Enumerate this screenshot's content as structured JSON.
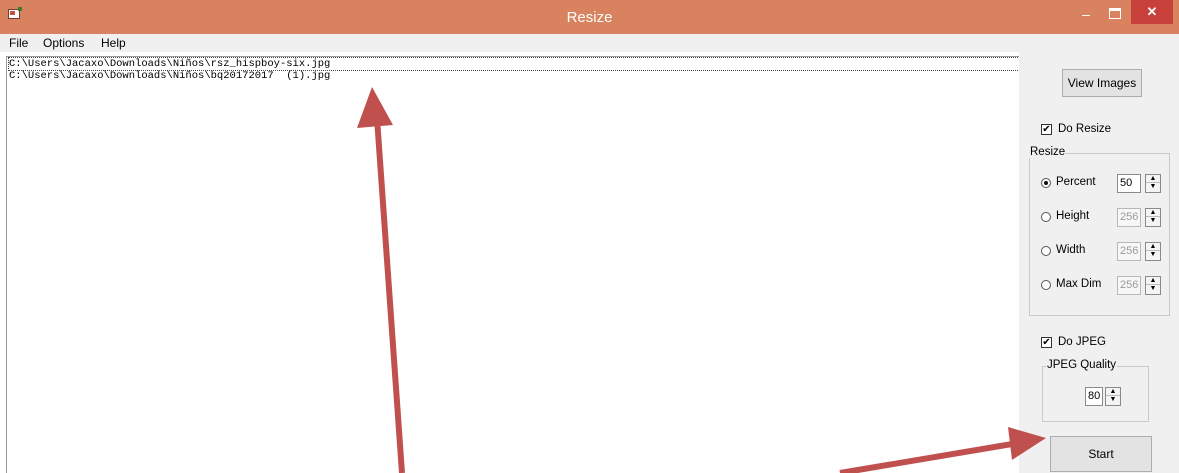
{
  "window": {
    "title": "Resize",
    "app_icon": "app-icon",
    "controls": {
      "minimize": "–",
      "close": "✕"
    }
  },
  "menu": [
    "File",
    "Options",
    "Help"
  ],
  "file_list": [
    "C:\\Users\\Jacaxo\\Downloads\\Niños\\rsz_hispboy-six.jpg",
    "C:\\Users\\Jacaxo\\Downloads\\Niños\\bq20172017  (1).jpg"
  ],
  "panel": {
    "view_images": "View Images",
    "do_resize": {
      "label": "Do Resize",
      "checked": true,
      "mark": "✔"
    },
    "resize_group": {
      "title": "Resize",
      "options": [
        {
          "label": "Percent",
          "value": "50",
          "checked": true
        },
        {
          "label": "Height",
          "value": "256",
          "checked": false
        },
        {
          "label": "Width",
          "value": "256",
          "checked": false
        },
        {
          "label": "Max Dim",
          "value": "256",
          "checked": false
        }
      ]
    },
    "do_jpeg": {
      "label": "Do JPEG",
      "checked": true,
      "mark": "✔"
    },
    "jpeg_group": {
      "title": "JPEG Quality",
      "value": "80"
    },
    "start": "Start"
  },
  "annotation_color": "#c0504d"
}
